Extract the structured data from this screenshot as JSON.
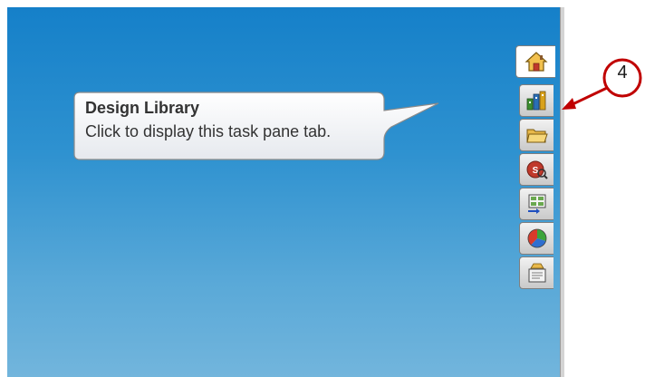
{
  "tooltip": {
    "title": "Design Library",
    "description": "Click to display this task pane tab."
  },
  "annotation": {
    "number": "4",
    "color": "#c00000"
  },
  "task_pane_tabs": [
    {
      "icon": "home-icon",
      "active": true
    },
    {
      "icon": "design-library-icon",
      "active": false
    },
    {
      "icon": "folder-icon",
      "active": false
    },
    {
      "icon": "view-palette-icon",
      "active": false
    },
    {
      "icon": "file-explorer-icon",
      "active": false
    },
    {
      "icon": "appearances-icon",
      "active": false
    },
    {
      "icon": "custom-properties-icon",
      "active": false
    }
  ],
  "colors": {
    "viewport_top": "#1580c9",
    "viewport_bottom": "#72b5dc"
  }
}
